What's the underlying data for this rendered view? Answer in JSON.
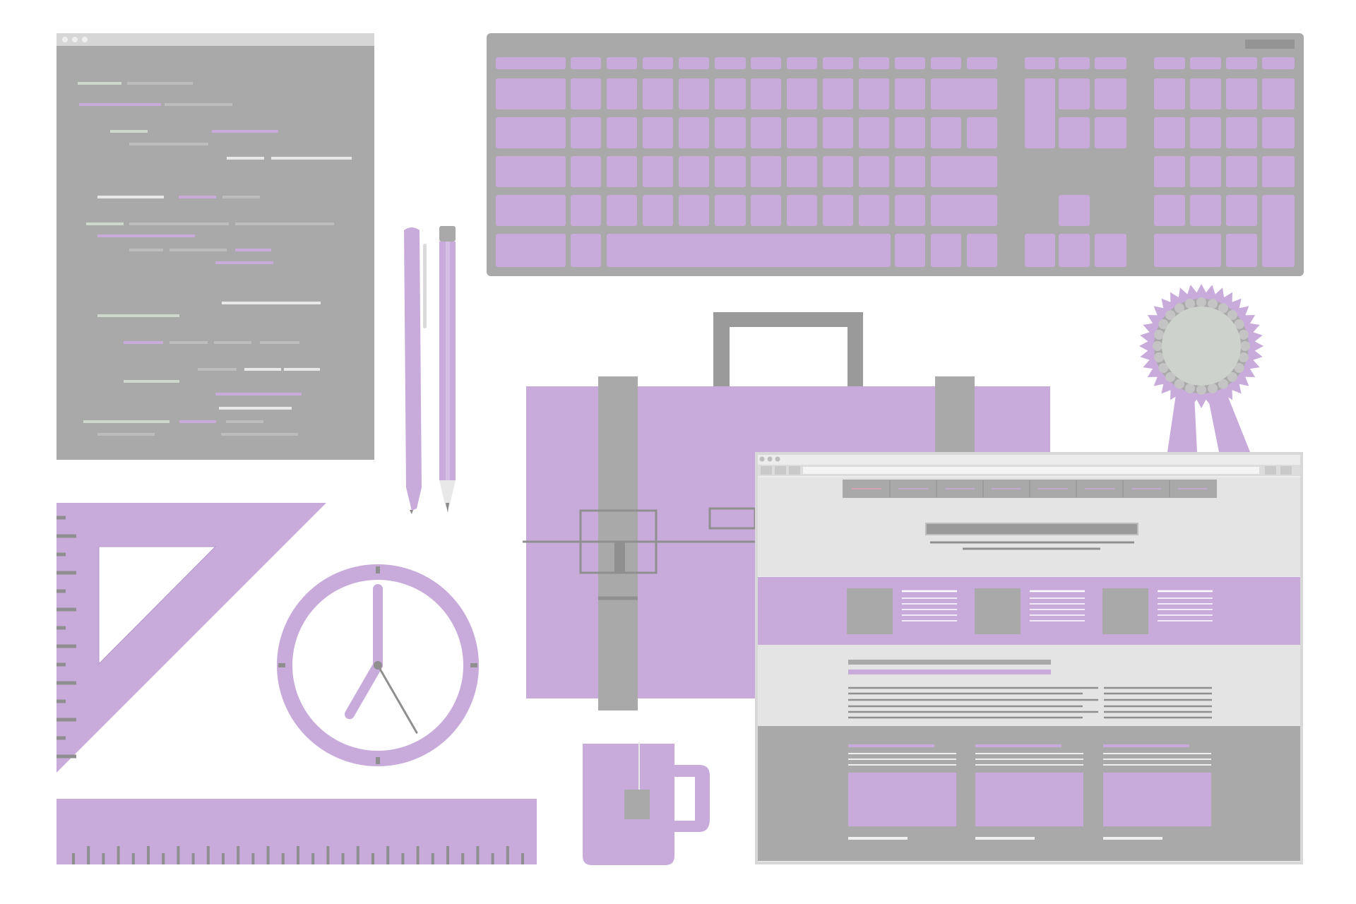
{
  "colors": {
    "lilac": "#c8abdb",
    "gray": "#a9a9a9",
    "dark_gray": "#9a9a9a",
    "light_gray": "#e4e4e4",
    "pale_green": "#cdd3cc",
    "white": "#ffffff"
  },
  "scene_objects": [
    "code-editor-window",
    "computer-keyboard",
    "pen",
    "pencil",
    "briefcase",
    "award-rosette",
    "website-browser-window",
    "set-square",
    "wall-clock",
    "ruler",
    "tea-mug"
  ],
  "clock": {
    "hour": 7,
    "minute": 0,
    "second": 25
  },
  "ruler": {
    "tick_count": 31
  },
  "keyboard": {
    "rows": 6
  },
  "website": {
    "nav_items": 8,
    "feature_blocks": 3,
    "footer_cards": 3
  }
}
